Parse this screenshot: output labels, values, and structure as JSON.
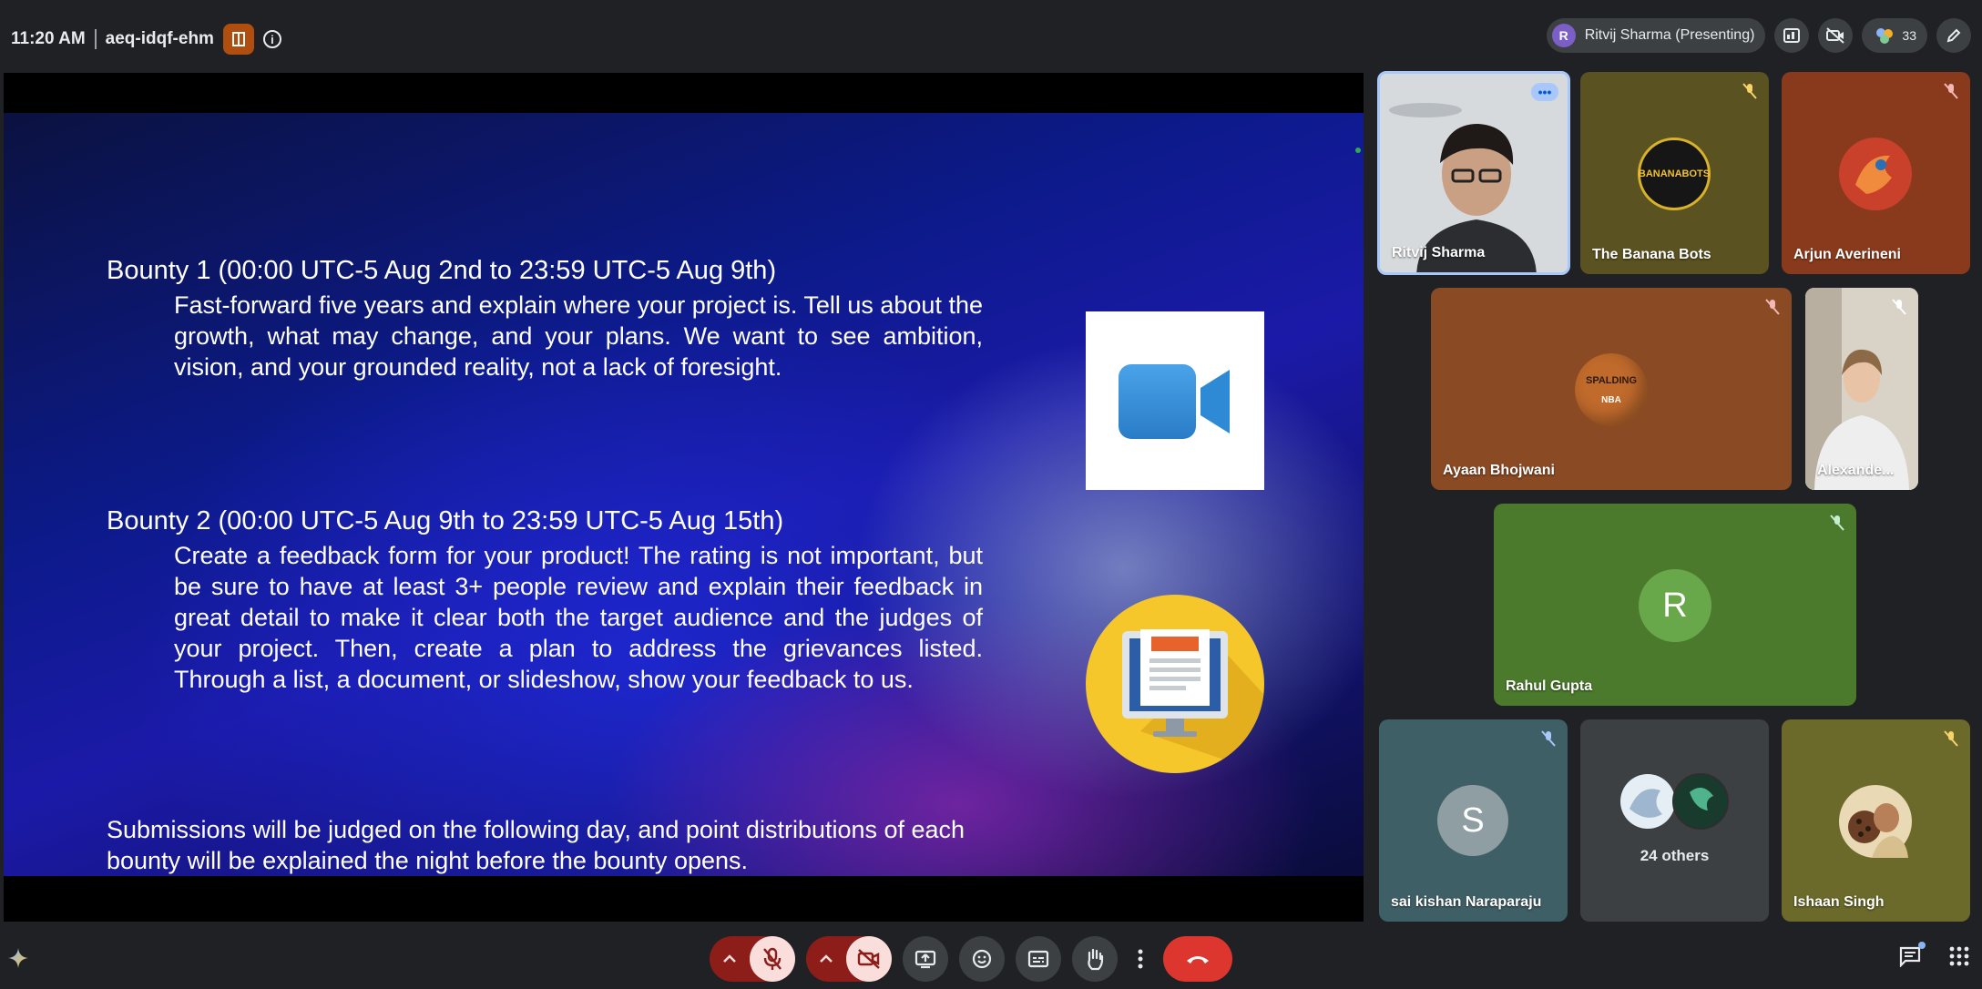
{
  "topbar": {
    "time": "11:20 AM",
    "meeting_code": "aeq-idqf-ehm",
    "presenter_initial": "R",
    "presenter_label": "Ritvij Sharma (Presenting)",
    "participant_count": "33"
  },
  "slide": {
    "bounty1_title": "Bounty 1 (00:00 UTC-5 Aug 2nd to 23:59 UTC-5 Aug 9th)",
    "bounty1_body": "Fast-forward five years and explain where your project is. Tell us about the growth, what may change, and your plans. We want to see ambition, vision, and your grounded reality, not a lack of foresight.",
    "bounty2_title": "Bounty 2 (00:00 UTC-5 Aug 9th to 23:59 UTC-5 Aug 15th)",
    "bounty2_body": "Create a feedback form for your product! The rating is not important, but be sure to have at least 3+ people review and explain their feedback in great detail to make it clear both the target audience and the judges of your project. Then, create a plan to address the grievances listed. Through a list, a document, or slideshow, show your feedback to us.",
    "footer": "Submissions will be judged on the following day, and point distributions of each bounty will be explained the night before the bounty opens."
  },
  "participants": [
    {
      "name": "Ritvij Sharma"
    },
    {
      "name": "The Banana Bots",
      "logo_text": "BANANABOTS"
    },
    {
      "name": "Arjun Averineni"
    },
    {
      "name": "Ayaan Bhojwani",
      "logo_text": "SPALDING",
      "logo_sub": "NBA"
    },
    {
      "name": "Alexande..."
    },
    {
      "name": "Rahul Gupta",
      "initial": "R"
    },
    {
      "name": "sai kishan Naraparaju",
      "initial": "S"
    },
    {
      "name": "24 others"
    },
    {
      "name": "Ishaan Singh"
    }
  ],
  "colors": {
    "hangup": "#dc362e",
    "mic_off_group": "#8c1d18",
    "tile_rahul": "#4b7a2c",
    "tile_banana": "#5a5220",
    "tile_arjun": "#8a3a1c",
    "tile_ayaan": "#8a4a24",
    "tile_sai": "#3f5f66",
    "tile_ishaan": "#6b6a2a"
  },
  "icons": {
    "gemini": "gemini-icon",
    "chat": "chat-icon",
    "activities": "apps-grid-icon"
  }
}
